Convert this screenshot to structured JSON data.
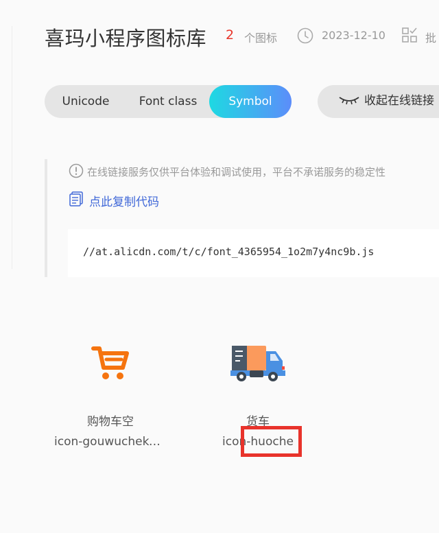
{
  "header": {
    "title": "喜玛小程序图标库",
    "icon_count": "2",
    "icon_count_unit": "个图标",
    "date": "2023-12-10",
    "batch_label": "批"
  },
  "tabs": [
    {
      "label": "Unicode",
      "active": false
    },
    {
      "label": "Font class",
      "active": false
    },
    {
      "label": "Symbol",
      "active": true
    }
  ],
  "collapse_button": {
    "label": "收起在线链接"
  },
  "notice": {
    "text": "在线链接服务仅供平台体验和调试使用，平台不承诺服务的稳定性",
    "copy_link": "点此复制代码"
  },
  "code": {
    "text": "//at.alicdn.com/t/c/font_4365954_1o2m7y4nc9b.js"
  },
  "icons": [
    {
      "name": "购物车空",
      "code": "icon-gouwuchekong",
      "glyph": "cart-icon"
    },
    {
      "name": "货车",
      "code": "icon-huoche",
      "glyph": "truck-icon"
    }
  ],
  "colors": {
    "accent_gradient_start": "#1ed9e2",
    "accent_gradient_end": "#5c8dfa",
    "count_red": "#e8352a",
    "link_blue": "#4068d8",
    "cart_orange": "#f5740f",
    "highlight_red": "#e8332b"
  }
}
